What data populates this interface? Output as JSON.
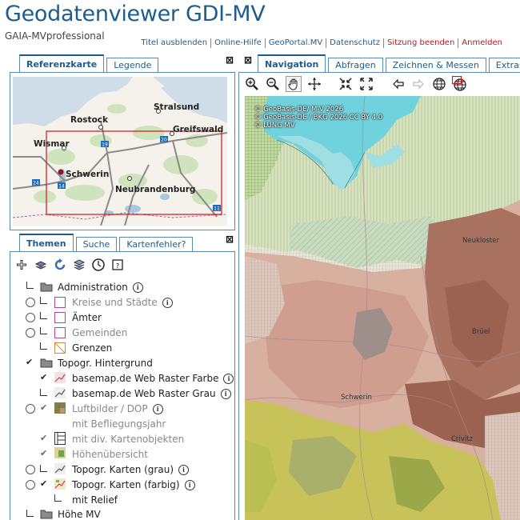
{
  "header": {
    "title": "Geodatenviewer GDI-MV",
    "subtitle": "GAIA-MVprofessional",
    "links": [
      {
        "label": "Titel ausblenden",
        "red": false
      },
      {
        "label": "Online-Hilfe",
        "red": false
      },
      {
        "label": "GeoPortal.MV",
        "red": false
      },
      {
        "label": "Datenschutz",
        "red": false
      },
      {
        "label": "Sitzung beenden",
        "red": true
      },
      {
        "label": "Anmelden",
        "red": true
      }
    ]
  },
  "top_left_tabs": [
    "Referenzkarte",
    "Legende"
  ],
  "reference_map": {
    "cities": [
      "Stralsund",
      "Rostock",
      "Greifswald",
      "Wismar",
      "Schwerin",
      "Neubrandenburg"
    ],
    "shields": [
      "19",
      "20",
      "24",
      "14",
      "11"
    ]
  },
  "bottom_left_tabs": [
    "Themen",
    "Suche",
    "Kartenfehler?"
  ],
  "theme_toolbar_icons": [
    "add-layer-icon",
    "layers-icon",
    "refresh-icon",
    "layers-stack-icon",
    "clock-icon",
    "map-legend-icon"
  ],
  "tree": {
    "items": [
      {
        "label": "Administration",
        "info": "i"
      },
      {
        "label": "Kreise und Städte",
        "info": "i"
      },
      {
        "label": "Ämter"
      },
      {
        "label": "Gemeinden"
      },
      {
        "label": "Grenzen"
      },
      {
        "label": "Topogr. Hintergrund"
      },
      {
        "label": "basemap.de Web Raster Farbe",
        "info": "i"
      },
      {
        "label": "basemap.de Web Raster Grau",
        "info": "i"
      },
      {
        "label": "Luftbilder / DOP",
        "info": "i"
      },
      {
        "label": "mit Befliegungsjahr"
      },
      {
        "label": "mit div. Kartenobjekten"
      },
      {
        "label": "Höhenübersicht"
      },
      {
        "label": "Topogr. Karten (grau)",
        "info": "i"
      },
      {
        "label": "Topogr. Karten (farbig)",
        "info": "i"
      },
      {
        "label": "mit Relief"
      },
      {
        "label": "Höhe MV"
      }
    ]
  },
  "right_tabs": [
    "Navigation",
    "Abfragen",
    "Zeichnen & Messen",
    "Extras"
  ],
  "map_toolbar_icons": [
    "zoom-in-icon",
    "zoom-out-icon",
    "pan-hand-icon",
    "move-cross-icon",
    "zoom-to-extent-icon",
    "full-extent-icon",
    "back-arrow-icon",
    "forward-arrow-icon",
    "globe-icon",
    "globe-select-icon"
  ],
  "main_map": {
    "copyright": [
      "© GeoBasis-DE/ M-V 2026",
      "© GeoBasis-DE / BKG 2026 CC BY 4.0",
      "© LUNG MV"
    ],
    "labels": [
      "Neukloster",
      "Brüel",
      "Schwerin",
      "Crivitz"
    ]
  }
}
